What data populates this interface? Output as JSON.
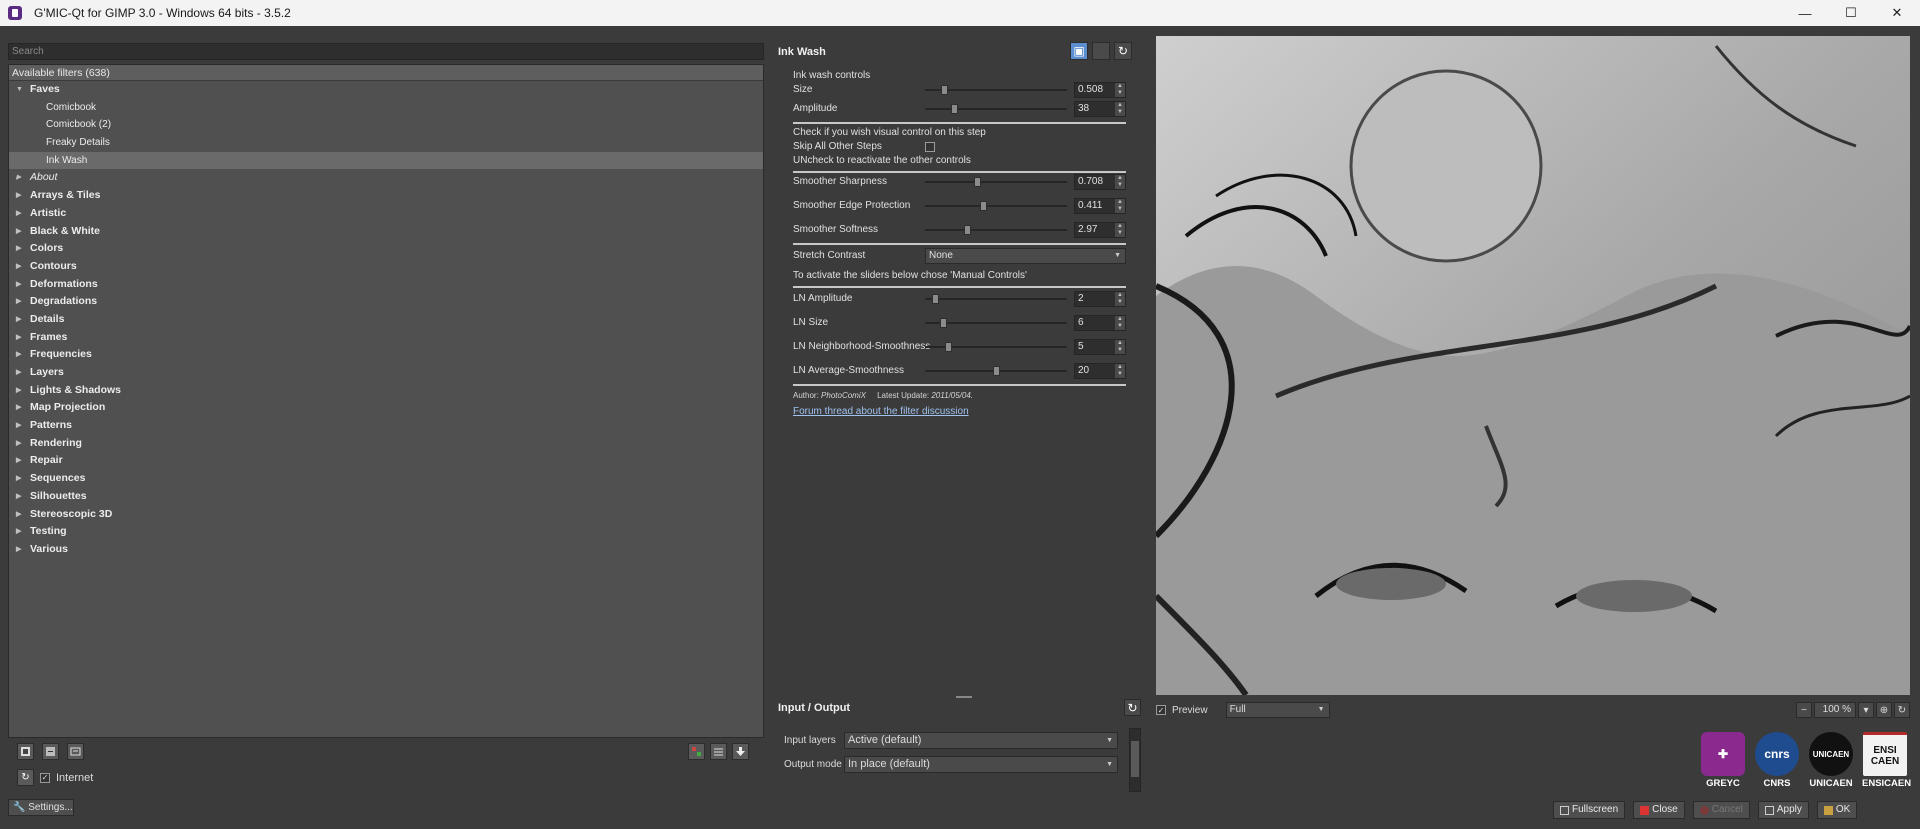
{
  "window": {
    "title": "G'MIC-Qt for GIMP 3.0 - Windows 64 bits - 3.5.2",
    "minimize": "—",
    "maximize": "☐",
    "close": "✕"
  },
  "left": {
    "search_placeholder": "Search",
    "available_header": "Available filters (638)",
    "tree": [
      {
        "label": "Faves",
        "kind": "cat",
        "expanded": true
      },
      {
        "label": "Comicbook",
        "kind": "sub"
      },
      {
        "label": "Comicbook (2)",
        "kind": "sub"
      },
      {
        "label": "Freaky Details",
        "kind": "sub"
      },
      {
        "label": "Ink Wash",
        "kind": "sub",
        "selected": true
      },
      {
        "label": "About",
        "kind": "cat",
        "italic": true
      },
      {
        "label": "Arrays & Tiles",
        "kind": "cat"
      },
      {
        "label": "Artistic",
        "kind": "cat"
      },
      {
        "label": "Black & White",
        "kind": "cat"
      },
      {
        "label": "Colors",
        "kind": "cat"
      },
      {
        "label": "Contours",
        "kind": "cat"
      },
      {
        "label": "Deformations",
        "kind": "cat"
      },
      {
        "label": "Degradations",
        "kind": "cat"
      },
      {
        "label": "Details",
        "kind": "cat"
      },
      {
        "label": "Frames",
        "kind": "cat"
      },
      {
        "label": "Frequencies",
        "kind": "cat"
      },
      {
        "label": "Layers",
        "kind": "cat"
      },
      {
        "label": "Lights & Shadows",
        "kind": "cat"
      },
      {
        "label": "Map Projection",
        "kind": "cat"
      },
      {
        "label": "Patterns",
        "kind": "cat"
      },
      {
        "label": "Rendering",
        "kind": "cat"
      },
      {
        "label": "Repair",
        "kind": "cat"
      },
      {
        "label": "Sequences",
        "kind": "cat"
      },
      {
        "label": "Silhouettes",
        "kind": "cat"
      },
      {
        "label": "Stereoscopic 3D",
        "kind": "cat"
      },
      {
        "label": "Testing",
        "kind": "cat"
      },
      {
        "label": "Various",
        "kind": "cat"
      }
    ],
    "internet_label": "Internet",
    "settings_label": "Settings..."
  },
  "filter": {
    "name": "Ink Wash",
    "section_label": "Ink wash controls",
    "size_label": "Size",
    "size_value": "0.508",
    "size_fraction": 0.12,
    "amplitude_label": "Amplitude",
    "amplitude_value": "38",
    "amplitude_fraction": 0.19,
    "check_note": "Check if you wish visual control on this step",
    "skip_label": "Skip All Other Steps",
    "uncheck_note": "UNcheck to reactivate the other controls",
    "smoother_sharpness_label": "Smoother Sharpness",
    "smoother_sharpness_value": "0.708",
    "smoother_sharpness_fraction": 0.36,
    "smoother_edge_label": "Smoother Edge Protection",
    "smoother_edge_value": "0.411",
    "smoother_edge_fraction": 0.41,
    "smoother_softness_label": "Smoother Softness",
    "smoother_softness_value": "2.97",
    "smoother_softness_fraction": 0.29,
    "stretch_label": "Stretch Contrast",
    "stretch_value": "None",
    "activate_note": "To activate the sliders below chose 'Manual Controls'",
    "ln_amplitude_label": "LN Amplitude",
    "ln_amplitude_value": "2",
    "ln_amplitude_fraction": 0.05,
    "ln_size_label": "LN Size",
    "ln_size_value": "6",
    "ln_size_fraction": 0.11,
    "ln_neigh_label": "LN Neighborhood-Smoothness",
    "ln_neigh_value": "5",
    "ln_neigh_fraction": 0.15,
    "ln_avg_label": "LN Average-Smoothness",
    "ln_avg_value": "20",
    "ln_avg_fraction": 0.5,
    "author_prefix": "Author:",
    "author_name": "PhotoComiX",
    "update_prefix": "Latest Update:",
    "update_date": "2011/05/04.",
    "forum_link": "Forum thread about the filter discussion"
  },
  "io": {
    "header": "Input / Output",
    "input_label": "Input layers",
    "input_value": "Active (default)",
    "output_label": "Output mode",
    "output_value": "In place (default)"
  },
  "preview": {
    "preview_label": "Preview",
    "mode_value": "Full",
    "zoom_value": "100 %"
  },
  "logos": [
    {
      "name": "GREYC",
      "color": "#8a2a8e"
    },
    {
      "name": "CNRS",
      "color": "#1f4b8f"
    },
    {
      "name": "UNICAEN",
      "color": "#111111"
    },
    {
      "name": "ENSICAEN",
      "color": "#b22a2a"
    }
  ],
  "logo_marks": {
    "cnrs": "cnrs",
    "unicaen": "UNICAEN",
    "ensicaen": "ENSI CAEN"
  },
  "buttons": {
    "fullscreen": "Fullscreen",
    "close": "Close",
    "cancel": "Cancel",
    "apply": "Apply",
    "ok": "OK"
  }
}
